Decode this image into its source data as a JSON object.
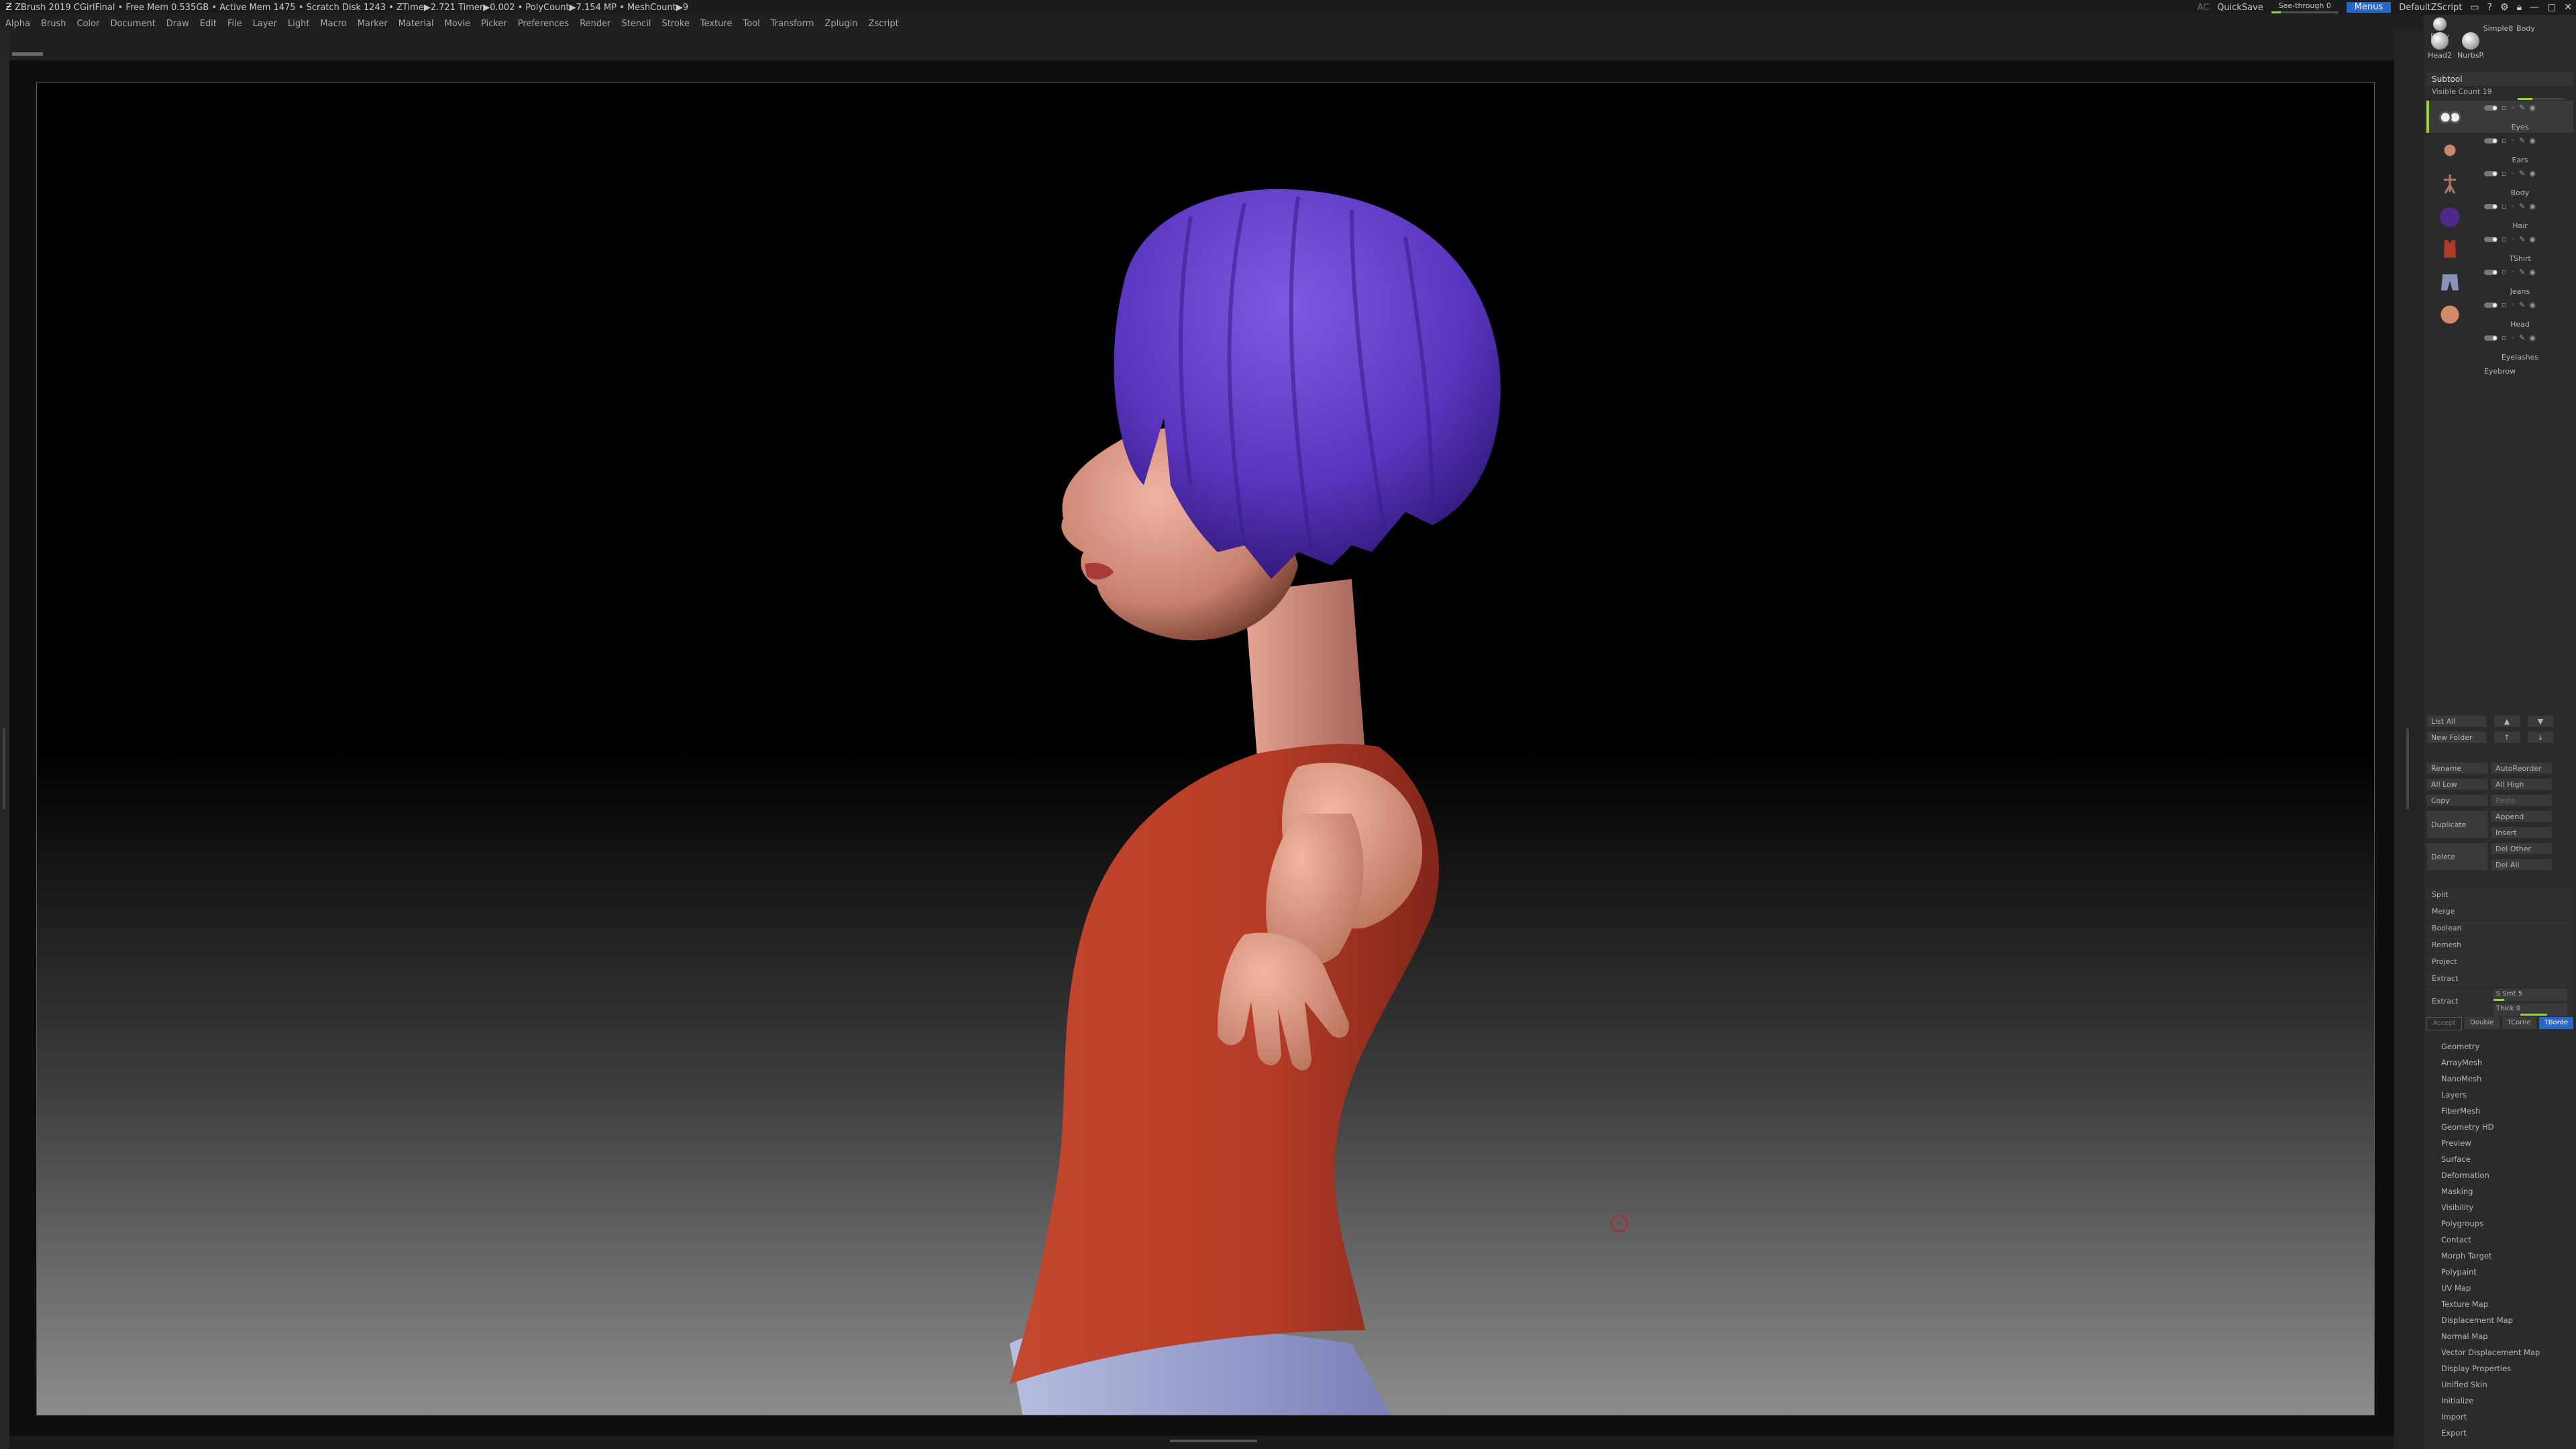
{
  "titlebar": {
    "text": "ZBrush 2019    CGirlFinal    • Free Mem 0.535GB • Active Mem 1475 • Scratch Disk 1243 •  ZTime▶2.721 Timer▶0.002 • PolyCount▶7.154 MP  • MeshCount▶9",
    "ac": "AC",
    "quicksave": "QuickSave",
    "see_through": "See-through  0",
    "see_through_value": 0,
    "menus": "Menus",
    "script": "DefaultZScript"
  },
  "menubar": [
    "Alpha",
    "Brush",
    "Color",
    "Document",
    "Draw",
    "Edit",
    "File",
    "Layer",
    "Light",
    "Macro",
    "Marker",
    "Material",
    "Movie",
    "Picker",
    "Preferences",
    "Render",
    "Stencil",
    "Stroke",
    "Texture",
    "Tool",
    "Transform",
    "Zplugin",
    "Zscript"
  ],
  "tool_thumbs": {
    "items": [
      {
        "label": "Body"
      },
      {
        "label": "Simple8"
      },
      {
        "label": "Body"
      },
      {
        "label": "Head2"
      },
      {
        "label": "NurbsP."
      }
    ]
  },
  "subtool": {
    "title": "Subtool",
    "visible_count": "Visible Count 19",
    "visible_fraction": 0.32,
    "items": [
      {
        "name": "Eyes",
        "color": "#c9c9c9",
        "active": true
      },
      {
        "name": "Ears",
        "color": "#7a4a3a",
        "active": false
      },
      {
        "name": "Body",
        "color": "#a07060",
        "active": false
      },
      {
        "name": "Hair",
        "color": "#4e2a8a",
        "active": false
      },
      {
        "name": "TShirt",
        "color": "#b03a28",
        "active": false
      },
      {
        "name": "Jeans",
        "color": "#8a92b8",
        "active": false
      },
      {
        "name": "Head",
        "color": "#c67a5a",
        "active": false
      },
      {
        "name": "Eyelashes",
        "color": "#333333",
        "active": false
      }
    ],
    "last_item": "Eyebrow"
  },
  "buttons": {
    "list_all": "List All",
    "new_folder": "New Folder",
    "rename": "Rename",
    "auto_reorder": "AutoReorder",
    "all_low": "All Low",
    "all_high": "All High",
    "copy": "Copy",
    "paste": "Paste",
    "duplicate": "Duplicate",
    "append": "Append",
    "insert": "Insert",
    "delete": "Delete",
    "del_other": "Del Other",
    "del_all": "Del All"
  },
  "operations": [
    "Split",
    "Merge",
    "Boolean",
    "Remesh",
    "Project",
    "Extract"
  ],
  "extract": {
    "label": "Extract",
    "s_smt": "S Smt 5",
    "s_smt_value": 5,
    "thick": "Thick 0",
    "thick_value": 0
  },
  "modes": [
    "Accept",
    "Double",
    "TCorne",
    "TBorde"
  ],
  "palettes": [
    "Geometry",
    "ArrayMesh",
    "NanoMesh",
    "Layers",
    "FiberMesh",
    "Geometry HD",
    "Preview",
    "Surface",
    "Deformation",
    "Masking",
    "Visibility",
    "Polygroups",
    "Contact",
    "Morph Target",
    "Polypaint",
    "UV Map",
    "Texture Map",
    "Displacement Map",
    "Normal Map",
    "Vector Displacement Map",
    "Display Properties",
    "Unified Skin",
    "Initialize",
    "Import",
    "Export"
  ]
}
